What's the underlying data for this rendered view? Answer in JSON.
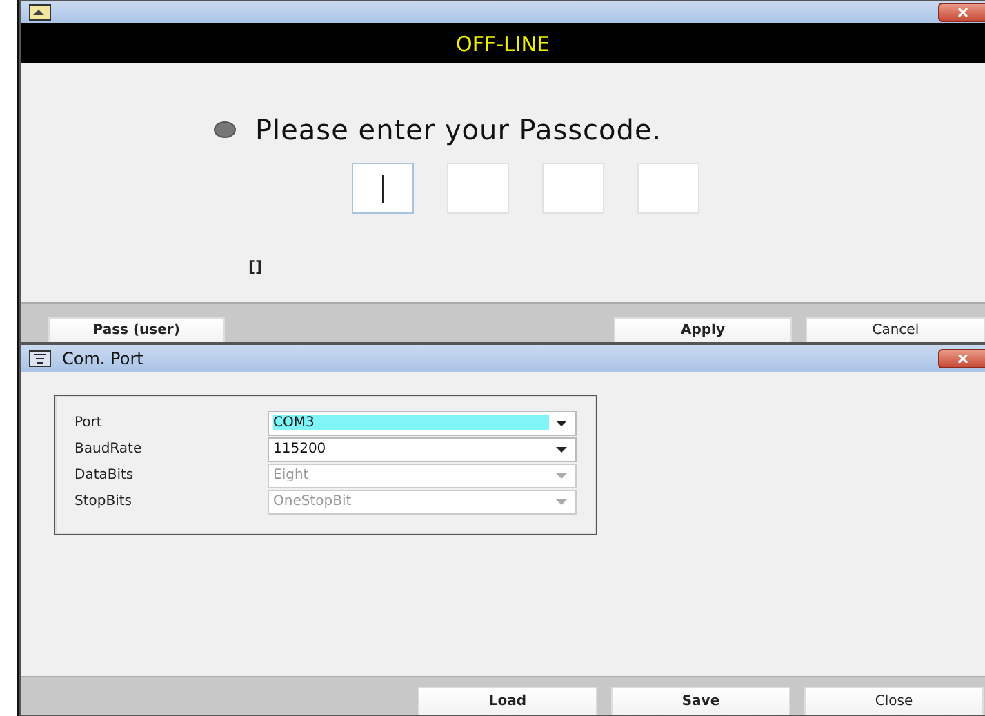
{
  "login_window": {
    "status_banner": "OFF-LINE",
    "prompt": "Please enter your Passcode.",
    "digits": [
      {
        "focused": true
      },
      {
        "focused": false
      },
      {
        "focused": false
      },
      {
        "focused": false
      }
    ],
    "message": "[]",
    "buttons": [
      {
        "label": "Pass (user)",
        "bold": true
      },
      {
        "label": "Apply",
        "bold": true
      },
      {
        "label": "Cancel",
        "bold": false
      }
    ]
  },
  "port_window": {
    "title": "Com. Port",
    "settings": [
      {
        "label": "Port",
        "value": "COM3",
        "disabled": false,
        "highlighted": true
      },
      {
        "label": "BaudRate",
        "value": "115200",
        "disabled": false,
        "highlighted": false
      },
      {
        "label": "DataBits",
        "value": "Eight",
        "disabled": true,
        "highlighted": false
      },
      {
        "label": "StopBits",
        "value": "OneStopBit",
        "disabled": true,
        "highlighted": false
      }
    ],
    "buttons": [
      {
        "label": "Load",
        "bold": true
      },
      {
        "label": "Save",
        "bold": true
      },
      {
        "label": "Close",
        "bold": false
      }
    ]
  }
}
